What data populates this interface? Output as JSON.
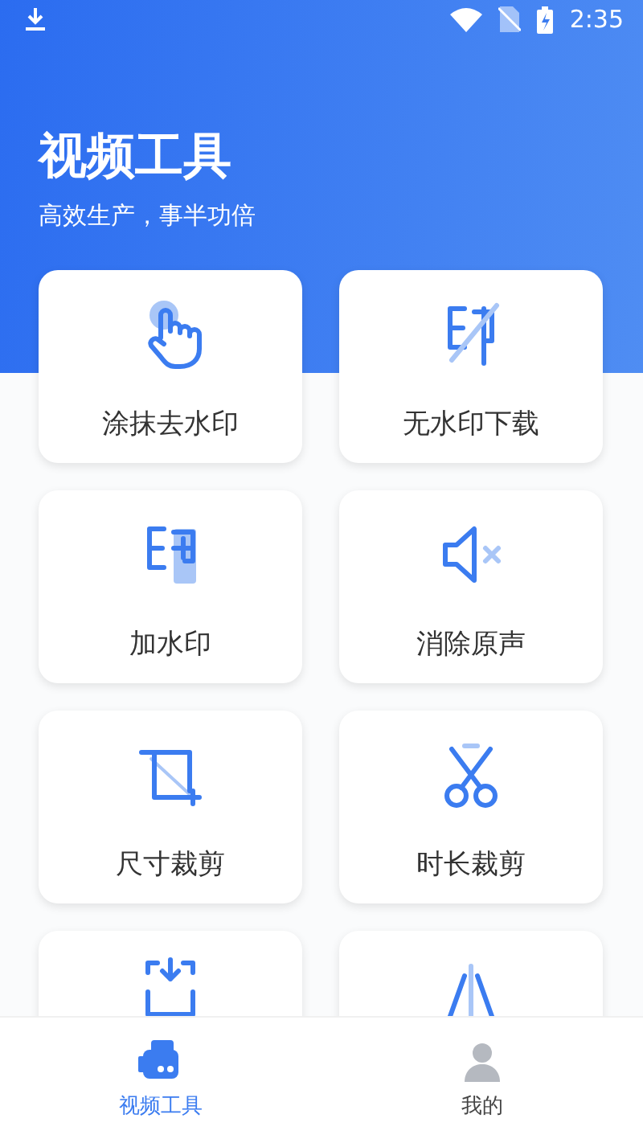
{
  "status_bar": {
    "time": "2:35"
  },
  "header": {
    "title": "视频工具",
    "subtitle": "高效生产，事半功倍"
  },
  "tools": [
    {
      "kind": "smear",
      "label": "涂抹去水印"
    },
    {
      "kind": "nomark",
      "label": "无水印下载"
    },
    {
      "kind": "addmark",
      "label": "加水印"
    },
    {
      "kind": "mute",
      "label": "消除原声"
    },
    {
      "kind": "crop",
      "label": "尺寸裁剪"
    },
    {
      "kind": "cut",
      "label": "时长裁剪"
    },
    {
      "kind": "import"
    },
    {
      "kind": "mirror"
    }
  ],
  "nav": [
    {
      "kind": "camera",
      "label": "视频工具",
      "selected": true
    },
    {
      "kind": "user",
      "label": "我的",
      "selected": false
    }
  ]
}
